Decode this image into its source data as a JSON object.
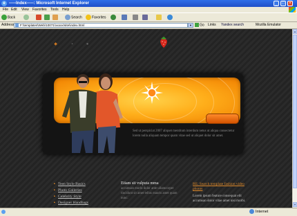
{
  "window": {
    "title": "-----Index-----: Microsoft Internet Explorer",
    "controls": {
      "minimize": "_",
      "maximize": "□",
      "close": "×"
    }
  },
  "menubar": {
    "items": [
      "File",
      "Edit",
      "View",
      "Favorites",
      "Tools",
      "Help"
    ]
  },
  "toolbar": {
    "back_label": "Back",
    "search_label": "Search",
    "favorites_label": "Favorites"
  },
  "addressbar": {
    "label": "Address",
    "url": "F:\\templates\\Web\\10071\\xxxxx\\site\\index.html",
    "go_label": "Go",
    "links_label": "Links",
    "search_brand": "Yandex search",
    "emulator_label": "Mozilla Emulator"
  },
  "site": {
    "panel_text": "Sed ut perspiciat 2007 aliquet mentitum interdum netus ut aliqua consectetur lorem nulla aliquam tempor quam vitae sed ut aliquet dolor sit amet.",
    "nav_items": [
      "Teen Style Basics",
      "Photo Galleries",
      "Celebrity Style",
      "Designer Handbags",
      "..."
    ],
    "col2_heading": "Etiam sit vulputa mma",
    "col2_text": "accumsan morbi dolor ante ullamcorper tincidunt sit amet tellus mauris amet quam nunc.",
    "col3_link": "RE: Search template fashion video photos",
    "col3_text": "Lorem ipsum feature consequat elit accumsan dolor vitae amet nisi morbi."
  },
  "statusbar": {
    "zone": "Internet"
  },
  "colors": {
    "accent_orange": "#ff9a1a",
    "page_background": "#262626",
    "link_orange": "#e08a2a"
  },
  "icons": [
    "internet-explorer-icon",
    "back-icon",
    "forward-icon",
    "stop-icon",
    "refresh-icon",
    "home-icon",
    "search-icon",
    "favorites-icon",
    "media-icon",
    "mail-icon",
    "print-icon",
    "edit-icon",
    "folder-icon",
    "messenger-icon",
    "strawberry-logo-icon",
    "sunburst-icon"
  ]
}
